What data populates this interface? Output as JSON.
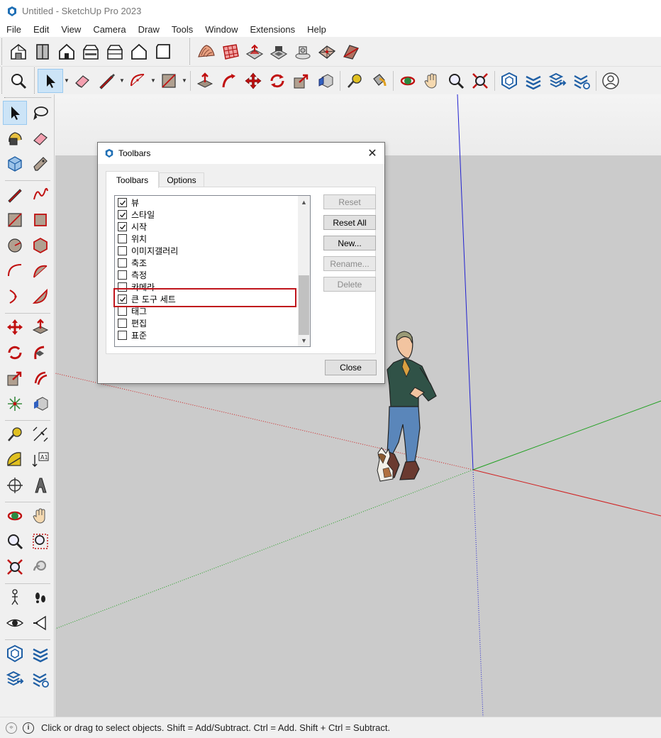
{
  "window": {
    "title": "Untitled - SketchUp Pro 2023"
  },
  "menu": [
    "File",
    "Edit",
    "View",
    "Camera",
    "Draw",
    "Tools",
    "Window",
    "Extensions",
    "Help"
  ],
  "toolbar_top": {
    "views": [
      "iso-view-icon",
      "top-view-icon",
      "front-view-icon",
      "right-view-icon",
      "back-view-icon",
      "left-view-icon",
      "bottom-view-icon"
    ],
    "sandbox": [
      "sandbox-contours-icon",
      "sandbox-grid-icon",
      "smoove-icon",
      "stamp-icon",
      "drape-icon",
      "add-detail-icon",
      "flip-edge-icon"
    ]
  },
  "dialog": {
    "title": "Toolbars",
    "close_symbol": "✕",
    "tabs": [
      "Toolbars",
      "Options"
    ],
    "items": [
      {
        "label": "뷰",
        "checked": true
      },
      {
        "label": "스타일",
        "checked": true
      },
      {
        "label": "시작",
        "checked": true
      },
      {
        "label": "위치",
        "checked": false
      },
      {
        "label": "이미지갤러리",
        "checked": false
      },
      {
        "label": "축조",
        "checked": false
      },
      {
        "label": "측정",
        "checked": false
      },
      {
        "label": "카메라",
        "checked": false
      },
      {
        "label": "큰 도구 세트",
        "checked": true
      },
      {
        "label": "태그",
        "checked": false
      },
      {
        "label": "편집",
        "checked": false
      },
      {
        "label": "표준",
        "checked": false
      }
    ],
    "buttons": {
      "reset": "Reset",
      "reset_all": "Reset All",
      "new": "New...",
      "rename": "Rename...",
      "delete": "Delete",
      "close": "Close"
    },
    "highlight_color": "#c0141c"
  },
  "status": {
    "text": "Click or drag to select objects. Shift = Add/Subtract. Ctrl = Add. Shift + Ctrl = Subtract."
  },
  "colors": {
    "axis_red": "#d02020",
    "axis_green": "#20a020",
    "axis_blue": "#2020d0",
    "ground": "#cbcbcb",
    "accent": "#99c9ef"
  }
}
